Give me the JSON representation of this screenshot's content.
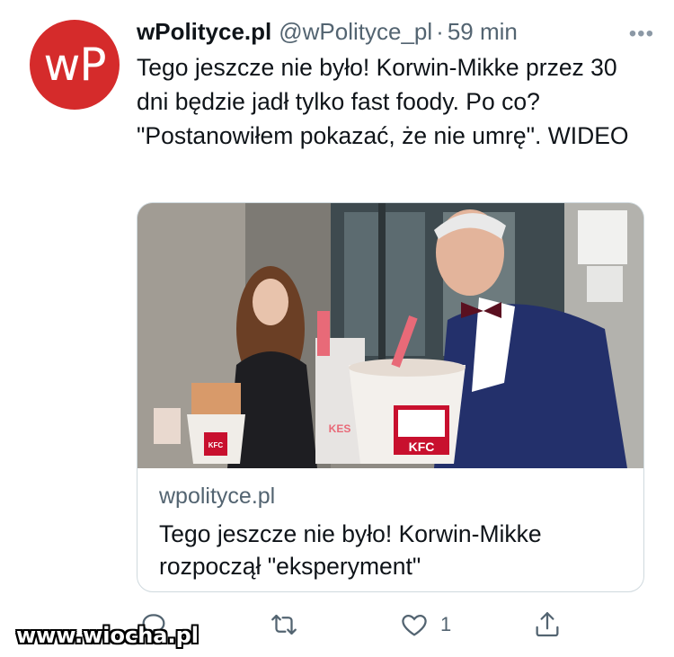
{
  "avatar": {
    "text": "wP",
    "color": "#d52b2b"
  },
  "header": {
    "display_name": "wPolityce.pl",
    "handle": "@wPolityce_pl",
    "separator": "·",
    "time": "59 min",
    "more_icon": "more-dots-icon"
  },
  "tweet": {
    "text": "Tego jeszcze nie było! Korwin-Mikke przez 30 dni będzie jadł tylko fast foody. Po co? \"Postanowiłem pokazać, że nie umrę\". WIDEO"
  },
  "card": {
    "domain": "wpolityce.pl",
    "title": "Tego jeszcze nie było! Korwin-Mikke rozpoczął \"eksperyment\"",
    "image_labels": {
      "bucket_brand": "KFC",
      "cup_text": "KES"
    }
  },
  "actions": {
    "reply_icon": "reply-icon",
    "retweet_icon": "retweet-icon",
    "like_icon": "heart-icon",
    "like_count": "1",
    "share_icon": "share-icon"
  },
  "watermark": {
    "text": "www.wiocha.pl"
  },
  "colors": {
    "secondary_text": "#536471",
    "border": "#cfd9de",
    "kfc_red": "#c8102e"
  }
}
